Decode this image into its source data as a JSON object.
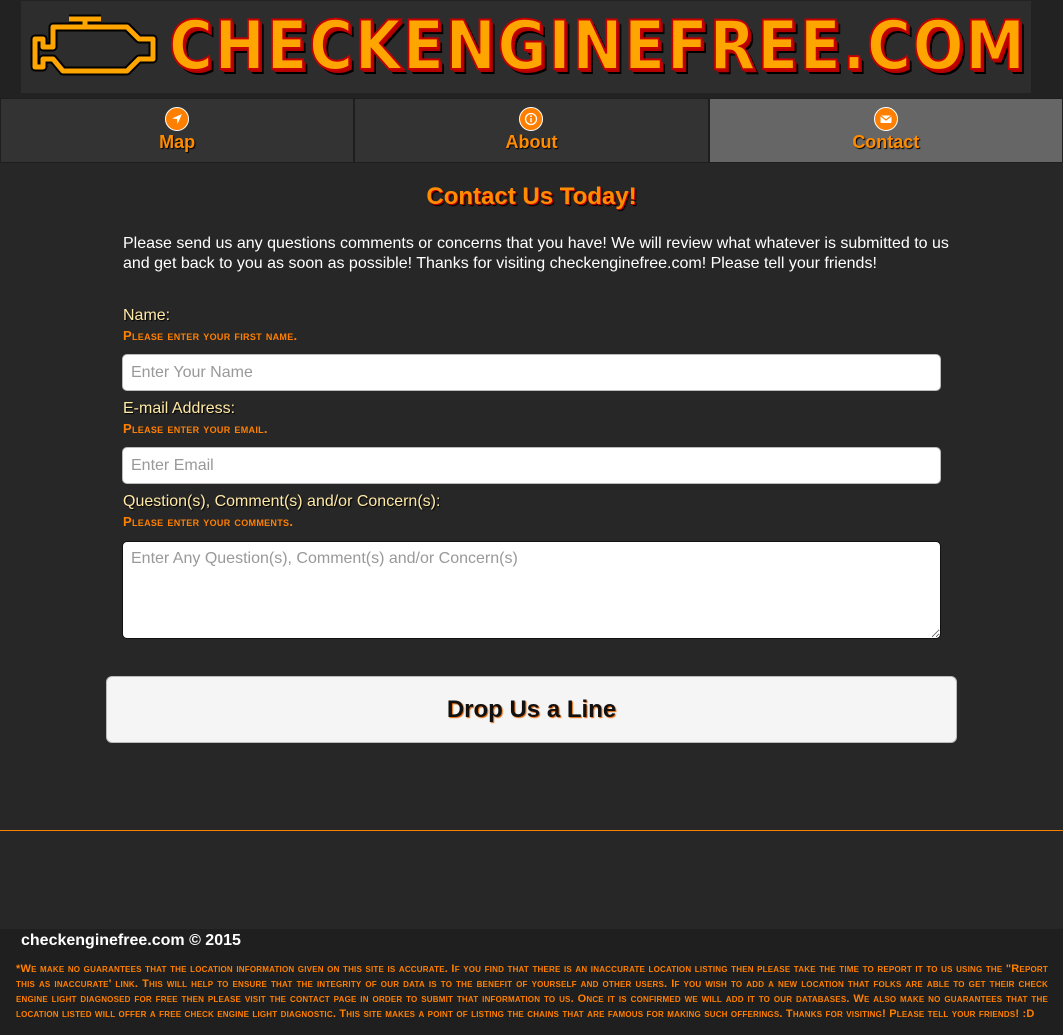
{
  "header": {
    "logo_text": "CHECKENGINEFREE.COM",
    "logo_icon": "check-engine-icon"
  },
  "nav": {
    "items": [
      {
        "label": "Map",
        "icon": "navigation-arrow-icon"
      },
      {
        "label": "About",
        "icon": "info-icon"
      },
      {
        "label": "Contact",
        "icon": "envelope-icon",
        "active": true
      }
    ]
  },
  "contact": {
    "title": "Contact Us Today!",
    "intro": "Please send us any questions comments or concerns that you have! We will review what whatever is submitted to us and get back to you as soon as possible! Thanks for visiting checkenginefree.com! Please tell your friends!",
    "name": {
      "label": "Name:",
      "hint": "Please enter your first name.",
      "placeholder": "Enter Your Name",
      "value": ""
    },
    "email": {
      "label": "E-mail Address:",
      "hint": "Please enter your email.",
      "placeholder": "Enter Email",
      "value": ""
    },
    "comments": {
      "label": "Question(s), Comment(s) and/or Concern(s):",
      "hint": "Please enter your comments.",
      "placeholder": "Enter Any Question(s), Comment(s) and/or Concern(s)",
      "value": ""
    },
    "submit_label": "Drop Us a Line"
  },
  "footer": {
    "copyright": "checkenginefree.com © 2015",
    "disclaimer": "*We make no guarantees that the location information given on this site is accurate. If you find that there is an inaccurate location listing then please take the time to report it to us using the \"Report this as inaccurate' link. This will help to ensure that the integrity of our data is to the benefit of yourself and other users. If you wish to add a new location that folks are able to get their check engine light diagnosed for free then please visit the contact page in order to submit that information to us. Once it is confirmed we will add it to our databases. We also make no guarantees that the location listed will offer a free check engine light diagnostic. This site makes a point of listing the chains that are famous for making such offerings. Thanks for visiting! Please tell your friends! :D"
  },
  "colors": {
    "accent": "#ff8c00",
    "background": "#272727",
    "active_tab": "#666666"
  }
}
